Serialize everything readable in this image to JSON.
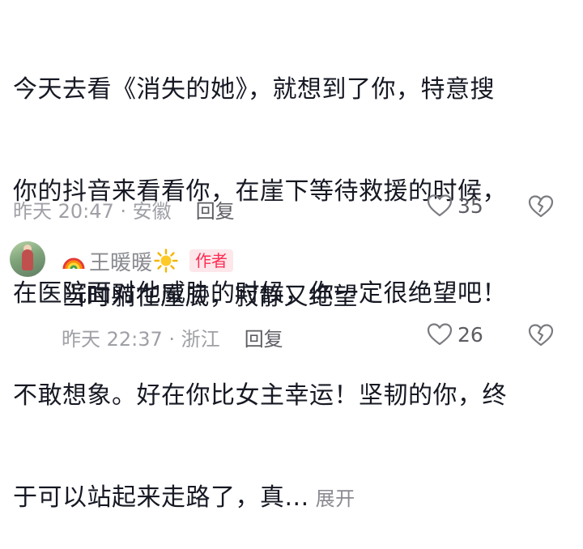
{
  "comment": {
    "lines": [
      "今天去看《消失的她》，就想到了你，特意搜",
      "你的抖音来看看你，在崖下等待救援的时候，",
      "在医院面对他威胁的时候，你一定很绝望吧！",
      "不敢想象。好在你比女主幸运！坚韧的你，终",
      "于可以站起来走路了，真..."
    ],
    "expand_label": "展开",
    "meta": "昨天 20:47 · 安徽",
    "reply_label": "回复",
    "like_count": "35"
  },
  "reply": {
    "name": "王暖暖",
    "name_emoji_prefix": "🌈",
    "name_emoji_suffix": "☀️",
    "badge": "作者",
    "text": "当时躺在崖底，寂静又绝望",
    "meta": "昨天 22:37 · 浙江",
    "reply_label": "回复",
    "like_count": "26"
  },
  "colors": {
    "primary_text": "#161823",
    "secondary_text": "#8a8b91",
    "badge_text": "#fe2c55",
    "badge_bg": "#fde7ea"
  },
  "icons": {
    "like": "heart-outline-icon",
    "dislike": "broken-heart-icon",
    "name_decoration_left": "rainbow-icon",
    "name_decoration_right": "sun-icon"
  }
}
